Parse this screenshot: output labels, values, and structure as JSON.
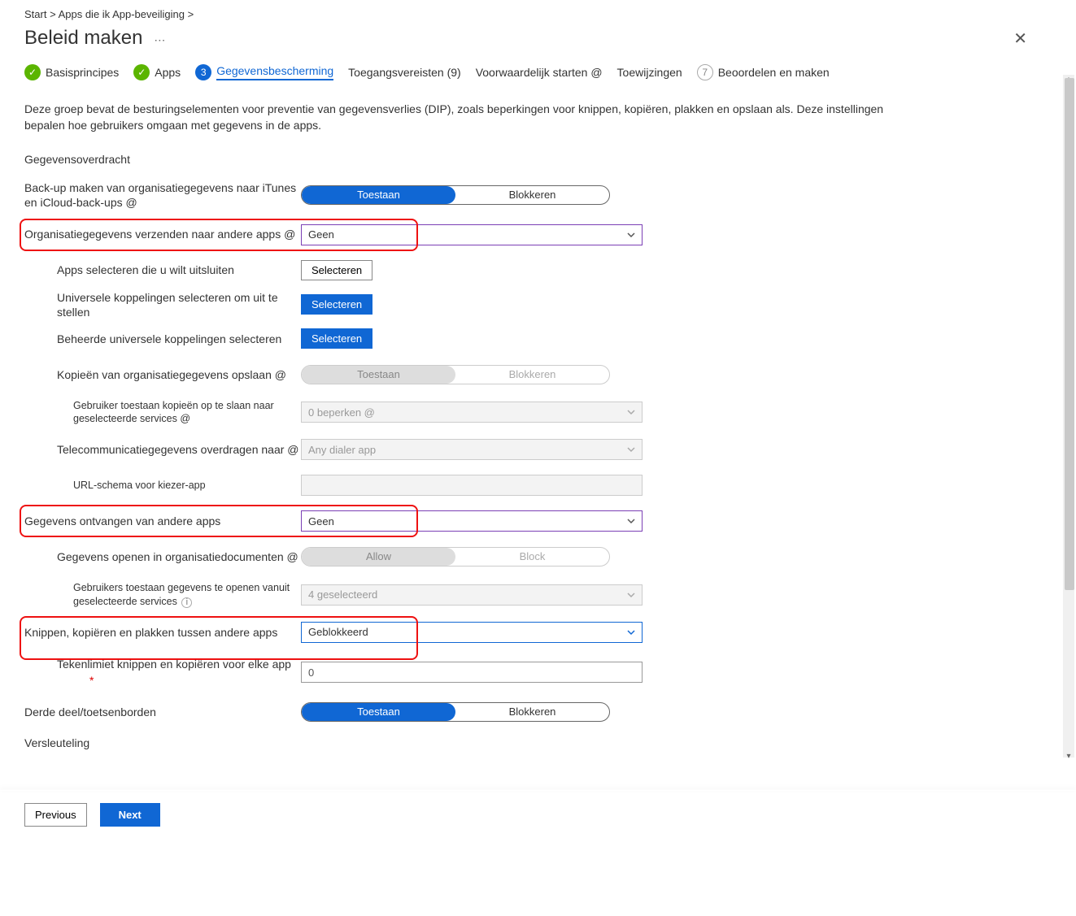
{
  "breadcrumb": {
    "start": "Start >",
    "path": "Apps die ik  App-beveiliging >"
  },
  "page_title": "Beleid maken",
  "steps": {
    "s1": "Basisprincipes",
    "s2": "Apps",
    "s3": "Gegevensbescherming",
    "s4": "Toegangsvereisten (9)",
    "s5": "Voorwaardelijk starten @",
    "s6": "Toewijzingen",
    "s7_num": "7",
    "s7": "Beoordelen en maken"
  },
  "intro": "Deze groep bevat de besturingselementen voor preventie van gegevensverlies (DIP), zoals beperkingen voor knippen, kopiëren, plakken en opslaan als. Deze instellingen bepalen hoe gebruikers omgaan met gegevens in de apps.",
  "section_transfer": "Gegevensoverdracht",
  "labels": {
    "backup": "Back-up maken van organisatiegegevens naar iTunes en iCloud-back-ups @",
    "send_other": "Organisatiegegevens verzenden naar andere apps @",
    "apps_exclude": "Apps selecteren die u wilt uitsluiten",
    "univ_links": "Universele koppelingen selecteren om uit te stellen",
    "managed_univ": "Beheerde universele koppelingen selecteren",
    "save_copies": "Kopieën van organisatiegegevens opslaan @",
    "allow_save_services": "Gebruiker toestaan kopieën op te slaan naar geselecteerde services @",
    "telecom": "Telecommunicatiegegevens overdragen naar @",
    "url_scheme": "URL-schema voor kiezer-app",
    "receive": "Gegevens ontvangen van andere apps",
    "open_in_docs": "Gegevens openen in organisatiedocumenten @",
    "allow_open_services": "Gebruikers toestaan gegevens te openen vanuit geselecteerde services",
    "cutcopy": "Knippen, kopiëren en plakken tussen andere apps",
    "char_limit": "Tekenlimiet knippen en kopiëren voor elke app",
    "third_kb": "Derde deel/toetsenborden",
    "encryption": "Versleuteling"
  },
  "values": {
    "allow": "Toestaan",
    "block": "Blokkeren",
    "allow_en": "Allow",
    "block_en": "Block",
    "none": "Geen",
    "select": "Selecteren",
    "restrict0": "0 beperken @",
    "dialer": "Any dialer app",
    "selected4": "4 geselecteerd",
    "blocked": "Geblokkeerd",
    "zero": "0"
  },
  "footer": {
    "prev": "Previous",
    "next": "Next"
  }
}
